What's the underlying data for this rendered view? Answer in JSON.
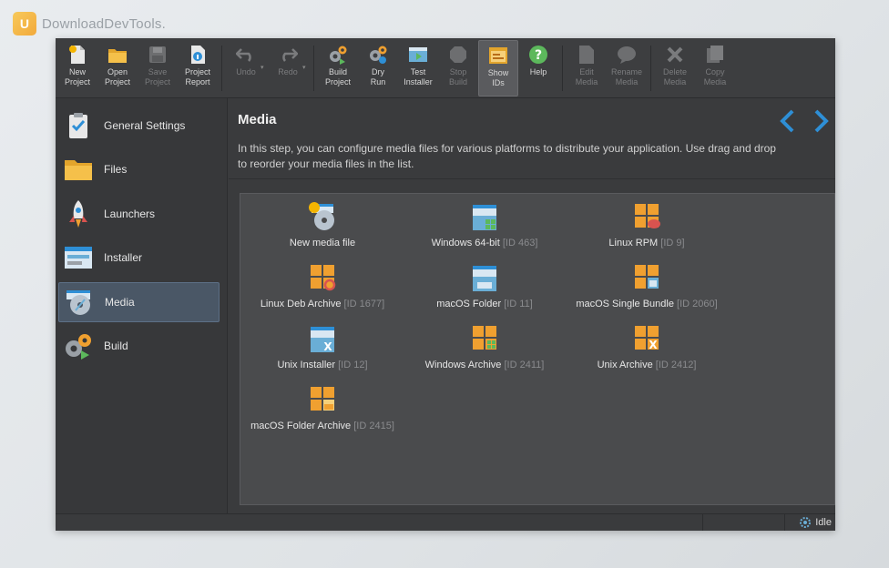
{
  "watermark": {
    "text": "DownloadDevTools."
  },
  "toolbar": {
    "buttons": [
      {
        "label": "New\nProject",
        "icon": "new-project-icon"
      },
      {
        "label": "Open\nProject",
        "icon": "open-folder-icon"
      },
      {
        "label": "Save\nProject",
        "icon": "save-icon"
      },
      {
        "label": "Project\nReport",
        "icon": "report-icon"
      },
      {
        "label": "Undo",
        "icon": "undo-icon"
      },
      {
        "label": "Redo",
        "icon": "redo-icon"
      },
      {
        "label": "Build\nProject",
        "icon": "build-gears-icon"
      },
      {
        "label": "Dry\nRun",
        "icon": "dry-run-icon"
      },
      {
        "label": "Test\nInstaller",
        "icon": "test-installer-icon"
      },
      {
        "label": "Stop\nBuild",
        "icon": "stop-icon"
      },
      {
        "label": "Show\nIDs",
        "icon": "show-ids-icon"
      },
      {
        "label": "Help",
        "icon": "help-icon"
      },
      {
        "label": "Edit\nMedia",
        "icon": "edit-media-icon"
      },
      {
        "label": "Rename\nMedia",
        "icon": "rename-media-icon"
      },
      {
        "label": "Delete\nMedia",
        "icon": "delete-icon"
      },
      {
        "label": "Copy\nMedia",
        "icon": "copy-media-icon"
      }
    ]
  },
  "sidebar": {
    "items": [
      {
        "label": "General Settings",
        "icon": "checklist-icon"
      },
      {
        "label": "Files",
        "icon": "folder-icon"
      },
      {
        "label": "Launchers",
        "icon": "rocket-icon"
      },
      {
        "label": "Installer",
        "icon": "installer-window-icon"
      },
      {
        "label": "Media",
        "icon": "media-disc-icon",
        "selected": true
      },
      {
        "label": "Build",
        "icon": "build-gears-icon"
      }
    ]
  },
  "main": {
    "title": "Media",
    "description": "In this step, you can configure media files for various platforms to distribute your application. Use drag and drop to reorder your media files in the list."
  },
  "media": [
    {
      "name": "New media file",
      "id": "",
      "icon": "new-media-icon"
    },
    {
      "name": "Windows 64-bit",
      "id": "[ID 463]",
      "icon": "windows-installer-icon"
    },
    {
      "name": "Linux RPM",
      "id": "[ID 9]",
      "icon": "linux-rpm-icon"
    },
    {
      "name": "Linux Deb Archive",
      "id": "[ID 1677]",
      "icon": "linux-deb-icon"
    },
    {
      "name": "macOS Folder",
      "id": "[ID 11]",
      "icon": "macos-folder-icon"
    },
    {
      "name": "macOS Single Bundle",
      "id": "[ID 2060]",
      "icon": "macos-bundle-icon"
    },
    {
      "name": "Unix Installer",
      "id": "[ID 12]",
      "icon": "unix-installer-icon"
    },
    {
      "name": "Windows Archive",
      "id": "[ID 2411]",
      "icon": "windows-archive-icon"
    },
    {
      "name": "Unix Archive",
      "id": "[ID 2412]",
      "icon": "unix-archive-icon"
    },
    {
      "name": "macOS Folder Archive",
      "id": "[ID 2415]",
      "icon": "macos-archive-icon"
    }
  ],
  "status": {
    "text": "Idle"
  },
  "colors": {
    "accent": "#2e8fd6",
    "app_bg": "#3a3b3d",
    "panel_bg": "#4a4b4d",
    "archive_orange": "#f0a030"
  }
}
